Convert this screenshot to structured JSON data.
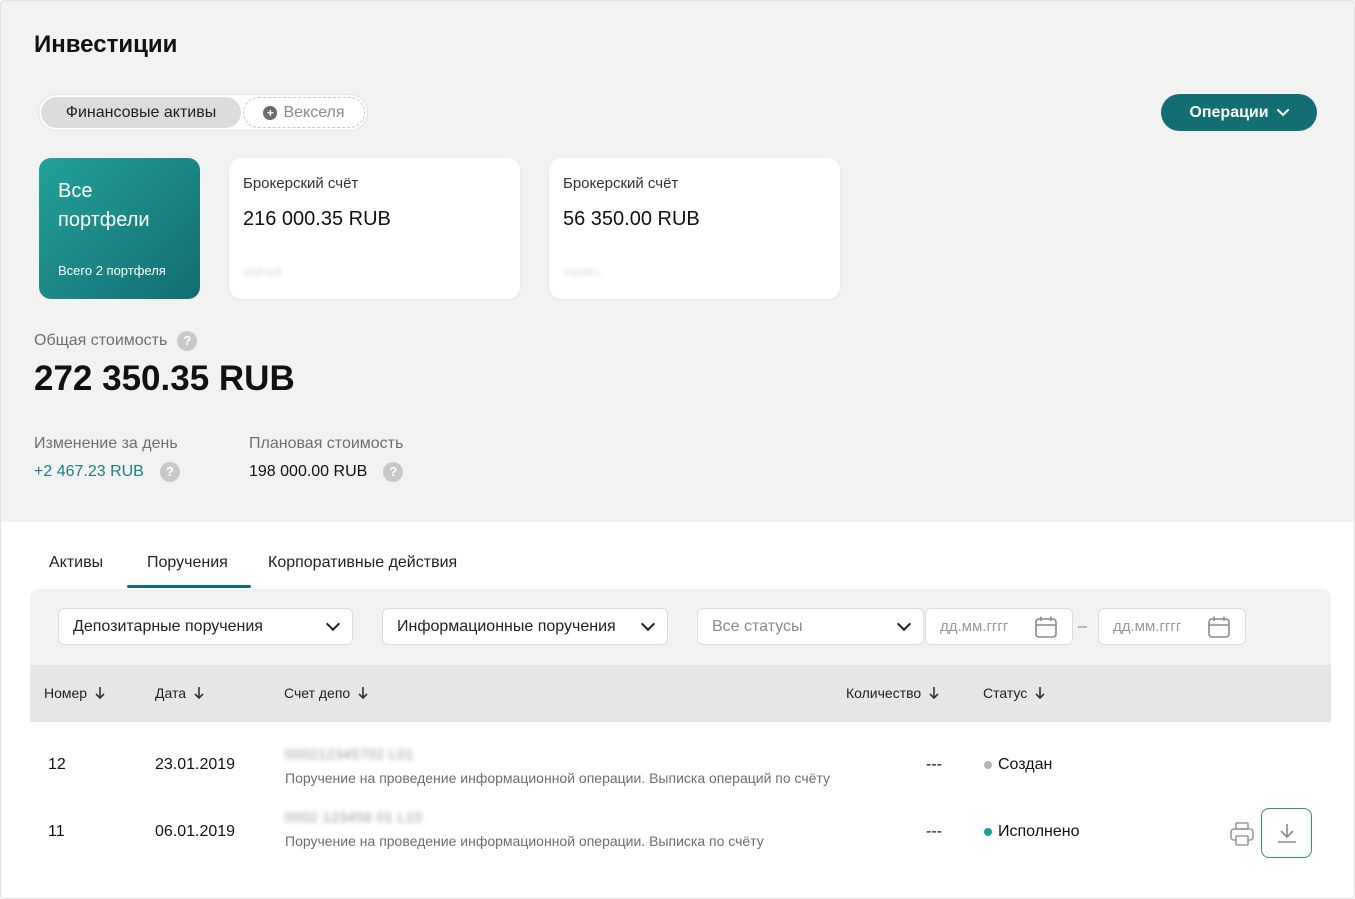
{
  "page": {
    "title": "Инвестиции"
  },
  "segmented": {
    "active": "Финансовые активы",
    "second": "Векселя",
    "second_icon": "plus-circle-icon"
  },
  "operations_button": {
    "label": "Операции"
  },
  "portfolio_all": {
    "title": "Все портфели",
    "subtitle": "Всего 2 портфеля"
  },
  "accounts": [
    {
      "label": "Брокерский счёт",
      "value": "216 000.35 RUB",
      "masked": "00FGA"
    },
    {
      "label": "Брокерский счёт",
      "value": "56 350.00 RUB",
      "masked": "03HKL"
    }
  ],
  "summary": {
    "total_label": "Общая стоимость",
    "total_value": "272 350.35 RUB",
    "day_change_label": "Изменение за день",
    "day_change_value": "+2 467.23 RUB",
    "planned_label": "Плановая стоимость",
    "planned_value": "198 000.00 RUB"
  },
  "tabs": [
    {
      "label": "Активы"
    },
    {
      "label": "Поручения"
    },
    {
      "label": "Корпоративные действия"
    }
  ],
  "filters": {
    "type": "Депозитарные поручения",
    "subtype": "Информационные поручения",
    "status": "Все статусы",
    "date_from_placeholder": "дд.мм.гггг",
    "date_to_placeholder": "дд.мм.гггг",
    "date_separator": "–"
  },
  "table": {
    "headers": {
      "number": "Номер",
      "date": "Дата",
      "account": "Счет депо",
      "quantity": "Количество",
      "status": "Статус"
    },
    "rows": [
      {
        "number": "12",
        "date": "23.01.2019",
        "account": "000212345702 L01",
        "description": "Поручение на проведение информационной операции. Выписка операций по счёту",
        "quantity": "---",
        "status": "Создан",
        "status_color": "#b5b5b5"
      },
      {
        "number": "11",
        "date": "06.01.2019",
        "account": "0002 123456 01 L10",
        "description": "Поручение на проведение информационной операции. Выписка по счёту",
        "quantity": "---",
        "status": "Исполнено",
        "status_color": "#1f9d8f"
      }
    ]
  },
  "colors": {
    "accent": "#136e73",
    "positive": "#1a7f86",
    "card_gradient_start": "#23a29b",
    "card_gradient_end": "#126c72"
  }
}
